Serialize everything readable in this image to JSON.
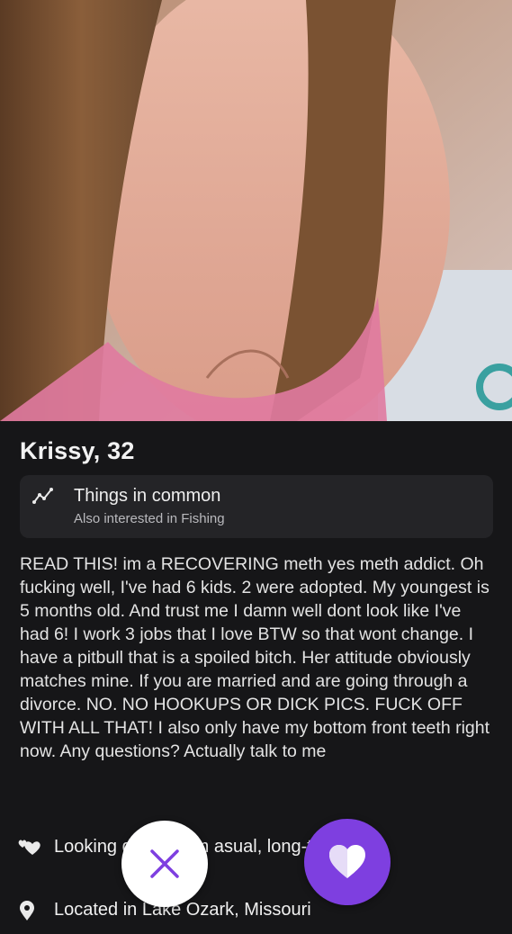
{
  "profile": {
    "name_age": "Krissy, 32",
    "things_in_common": {
      "title": "Things in common",
      "subtitle": "Also interested in Fishing",
      "icon": "trending-icon"
    },
    "bio": "READ THIS! im a RECOVERING meth yes meth addict.  Oh fucking well, I've had 6 kids. 2 were adopted. My youngest is 5 months old. And trust me I damn well dont look like I've had 6! I work 3 jobs that I love BTW so that wont change. I have a pitbull that is a spoiled bitch. Her attitude obviously matches mine. If you are married and are going through a divorce. NO. NO HOOKUPS OR DICK PICS. FUCK OFF WITH ALL THAT! I also only have my bottom front teeth right now. Any questions? Actually talk to me",
    "looking_for": {
      "text": "Looking                    dship, som                  asual, long-term re",
      "icon": "hearts-icon"
    },
    "location": {
      "text": "Located in Lake Ozark, Missouri",
      "icon": "location-pin-icon"
    }
  },
  "actions": {
    "pass_icon": "close-icon",
    "like_icon": "heart-icon",
    "accent_color": "#7e3fe0"
  }
}
